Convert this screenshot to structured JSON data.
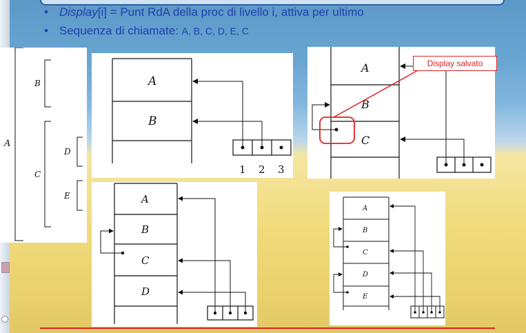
{
  "slide": {
    "bullet1": {
      "em": "Display",
      "rest": "[i] = Punt RdA della proc di livello i, attiva per ultimo"
    },
    "bullet2": {
      "prefix": "Sequenza di chiamate: ",
      "seq": "A, B, C, D, E, C"
    }
  },
  "tree": {
    "a": "A",
    "b": "B",
    "c": "C",
    "d": "D",
    "e": "E"
  },
  "fig1": {
    "a": "A",
    "b": "B",
    "i1": "1",
    "i2": "2",
    "i3": "3"
  },
  "fig2": {
    "a": "A",
    "b": "B",
    "c": "C",
    "callout": "Display salvato"
  },
  "fig3": {
    "a": "A",
    "b": "B",
    "c": "C",
    "d": "D"
  },
  "fig4": {
    "a": "A",
    "b": "B",
    "c": "C",
    "d": "D",
    "e": "E"
  },
  "colors": {
    "accent": "#d22222",
    "text": "#1f3fb0"
  }
}
